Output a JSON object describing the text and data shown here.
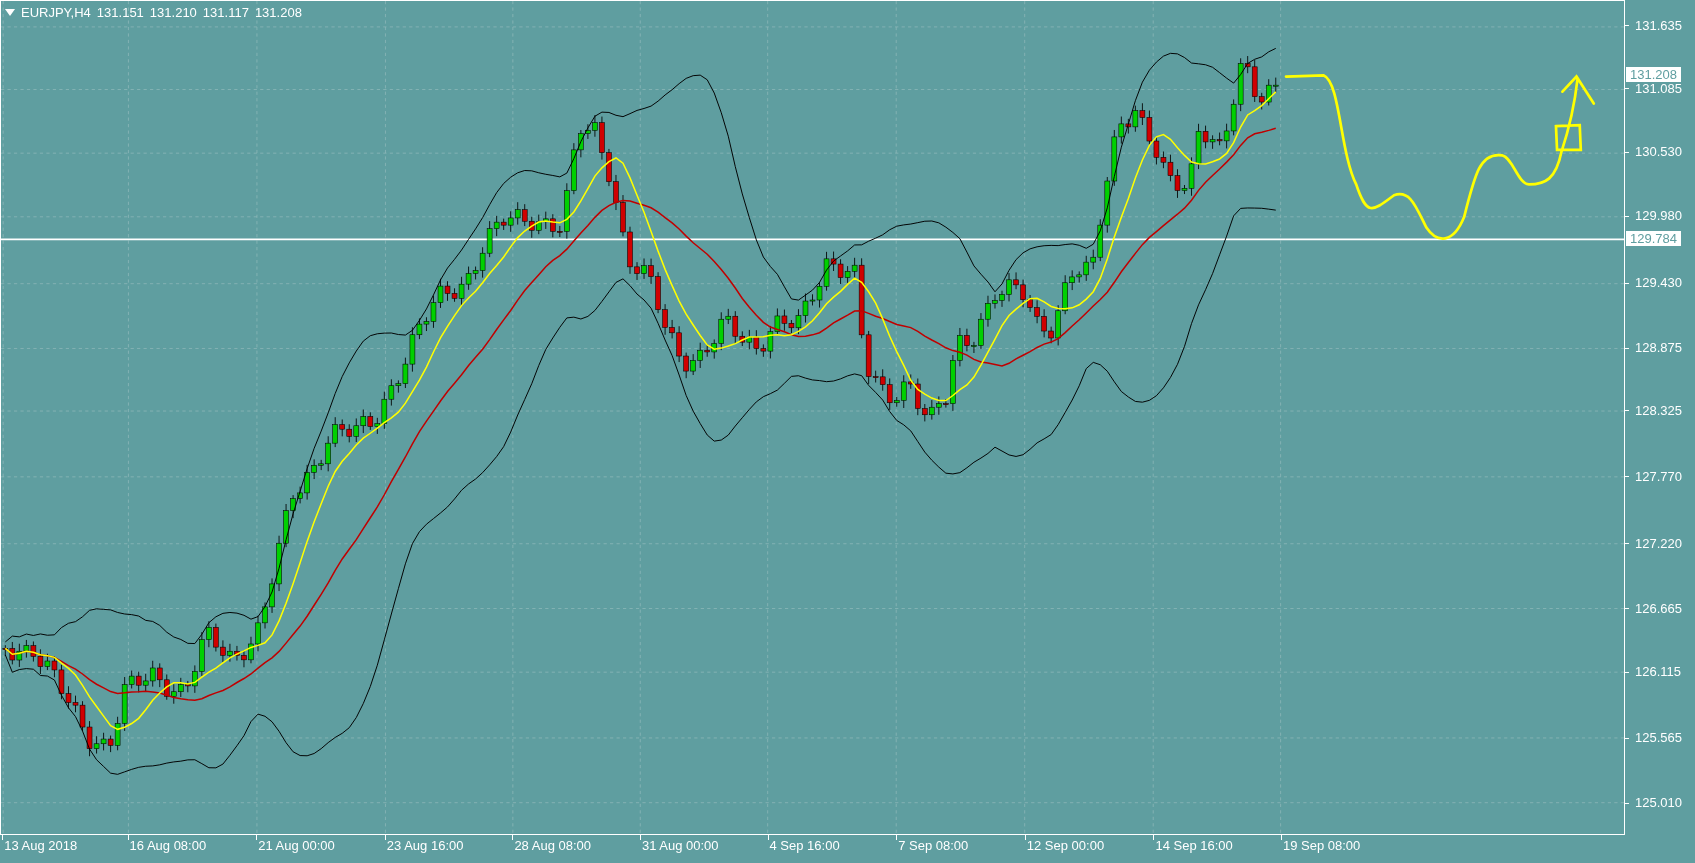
{
  "chart": {
    "symbol_label": "EURJPY,H4",
    "ohlc": [
      "131.151",
      "131.210",
      "131.117",
      "131.208"
    ],
    "price_axis": [
      "131.635",
      "131.085",
      "130.530",
      "129.980",
      "129.430",
      "128.875",
      "128.325",
      "127.770",
      "127.220",
      "126.665",
      "126.115",
      "125.565",
      "125.010"
    ],
    "price_markers": [
      {
        "kind": "bid",
        "text": "131.208"
      },
      {
        "kind": "hline",
        "text": "129.784"
      }
    ],
    "time_axis": [
      "13 Aug 2018",
      "16 Aug 08:00",
      "21 Aug 00:00",
      "23 Aug 16:00",
      "28 Aug 08:00",
      "31 Aug 00:00",
      "4 Sep 16:00",
      "7 Sep 08:00",
      "12 Sep 00:00",
      "14 Sep 16:00",
      "19 Sep 08:00"
    ]
  }
}
